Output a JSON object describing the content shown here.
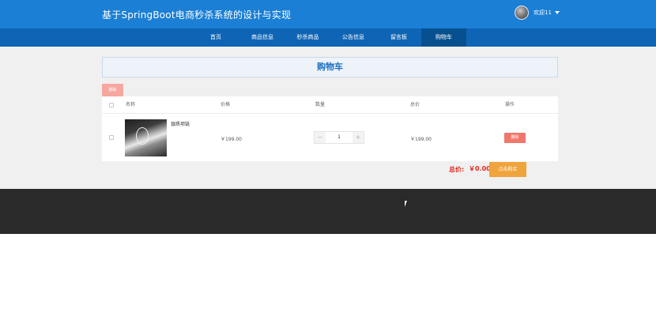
{
  "header": {
    "site_title": "基于SpringBoot电商秒杀系统的设计与实现",
    "welcome_text": "欢迎11"
  },
  "nav": {
    "items": [
      {
        "label": "首页"
      },
      {
        "label": "商品信息"
      },
      {
        "label": "秒杀商品"
      },
      {
        "label": "公告信息"
      },
      {
        "label": "留言板"
      },
      {
        "label": "购物车"
      }
    ],
    "active": "购物车"
  },
  "page": {
    "title": "购物车",
    "batch_delete_label": "删除"
  },
  "table": {
    "headers": {
      "name": "名称",
      "price": "价格",
      "quantity": "数量",
      "total": "总价",
      "action": "操作"
    },
    "rows": [
      {
        "name": "银质项链",
        "price": "￥199.00",
        "quantity": "1",
        "decrement": "－",
        "increment": "＋",
        "total": "￥199.00",
        "delete_label": "删除"
      }
    ]
  },
  "summary": {
    "total_label": "总价:",
    "total_amount": "￥0.00",
    "buy_label": "点击购买"
  },
  "colors": {
    "header_bg": "#1a7fd5",
    "nav_bg": "#0f65b5",
    "nav_active_bg": "#07508f",
    "accent_red": "#e02a1f",
    "delete_button": "#f0776c",
    "buy_button": "#f0a43c",
    "footer_bg": "#2a2a2a"
  }
}
